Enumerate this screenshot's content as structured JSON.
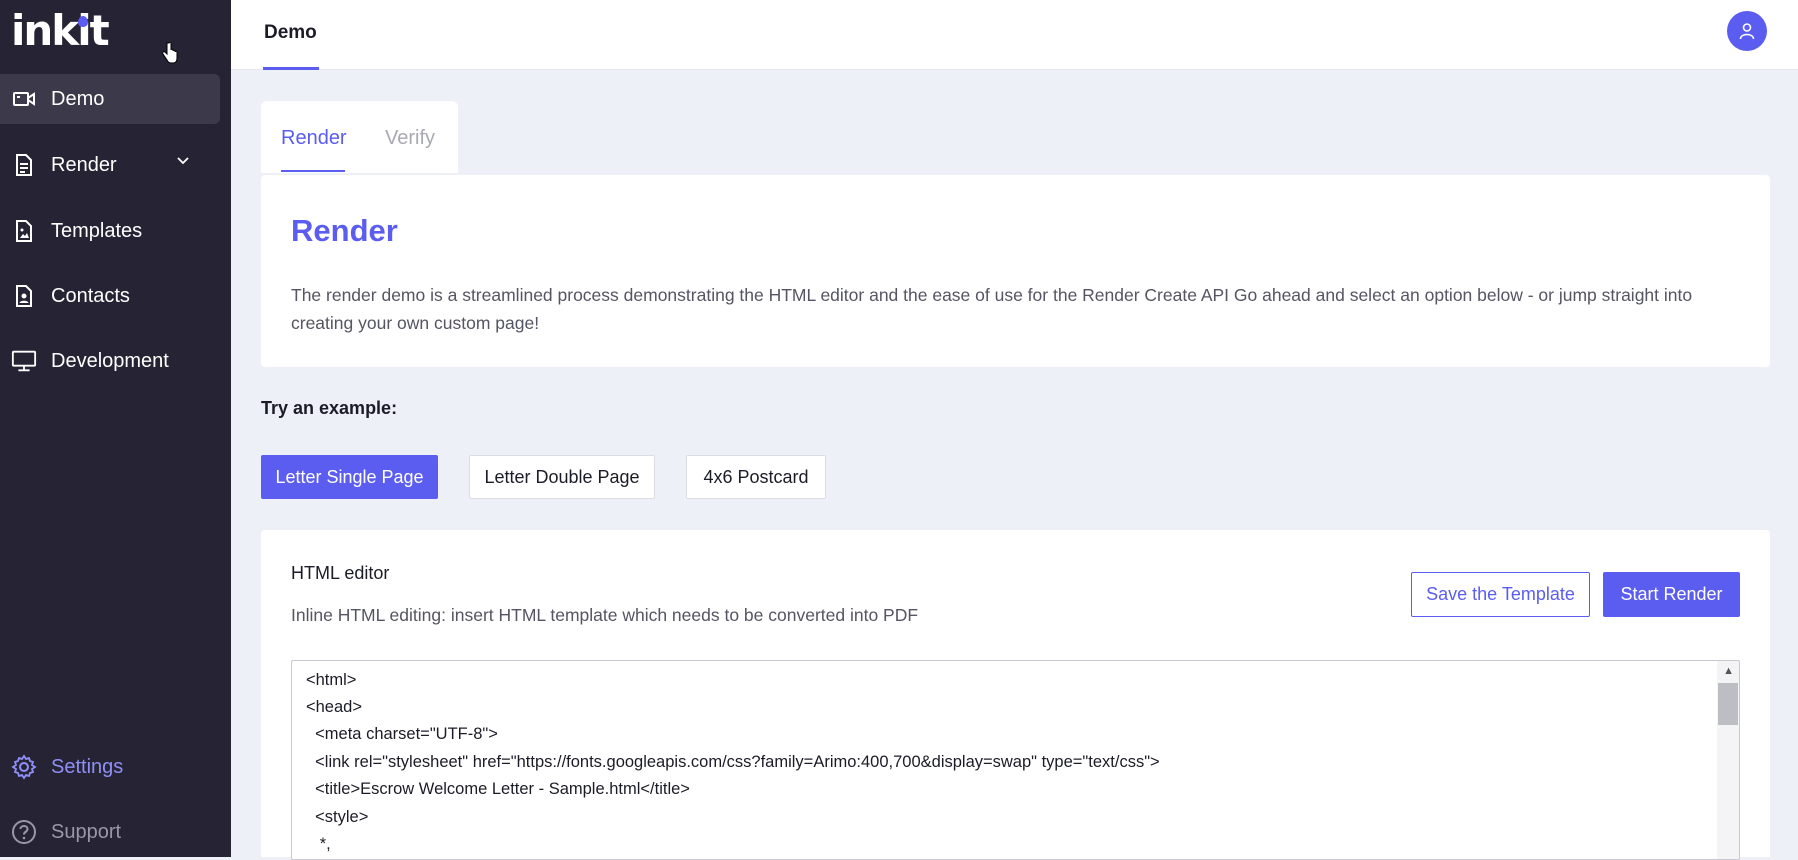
{
  "app": {
    "logo_text": "inkit"
  },
  "sidebar": {
    "items": [
      {
        "label": "Demo",
        "icon": "video-camera-icon"
      },
      {
        "label": "Render",
        "icon": "document-icon"
      },
      {
        "label": "Templates",
        "icon": "image-file-icon"
      },
      {
        "label": "Contacts",
        "icon": "contact-file-icon"
      },
      {
        "label": "Development",
        "icon": "monitor-icon"
      }
    ],
    "bottom": [
      {
        "label": "Settings",
        "icon": "gear-icon"
      },
      {
        "label": "Support",
        "icon": "question-circle-icon"
      }
    ]
  },
  "topbar": {
    "breadcrumb": "Demo"
  },
  "tabs": {
    "render": "Render",
    "verify": "Verify"
  },
  "render_card": {
    "title": "Render",
    "description": "The render demo is a streamlined process demonstrating the HTML editor and the ease of use for the Render Create API Go ahead and select an option below - or jump straight into creating your own custom page!"
  },
  "examples": {
    "label": "Try an example:",
    "buttons": [
      "Letter Single Page",
      "Letter Double Page",
      "4x6 Postcard"
    ]
  },
  "editor": {
    "title": "HTML editor",
    "subtitle": "Inline HTML editing: insert HTML template which needs to be converted into PDF",
    "save_label": "Save the Template",
    "start_label": "Start Render",
    "code_lines": [
      "<html>",
      "<head>",
      "  <meta charset=\"UTF-8\">",
      "  <link rel=\"stylesheet\" href=\"https://fonts.googleapis.com/css?family=Arimo:400,700&display=swap\" type=\"text/css\">",
      "  <title>Escrow Welcome Letter - Sample.html</title>",
      "  <style>",
      "   *,"
    ]
  },
  "colors": {
    "accent": "#5b5cf0",
    "sidebar_bg": "#262434",
    "page_bg": "#eef0f8"
  }
}
